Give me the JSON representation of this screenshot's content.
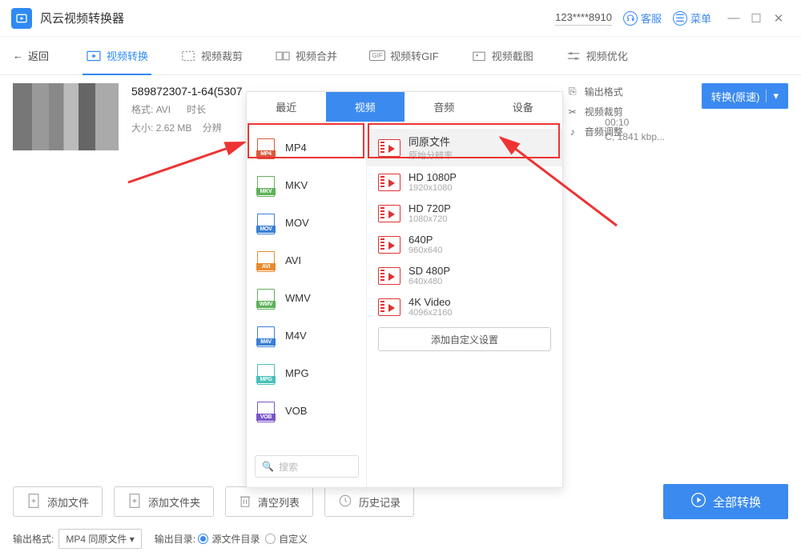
{
  "titlebar": {
    "app": "风云视频转换器",
    "account": "123****8910",
    "support": "客服",
    "menu": "菜单"
  },
  "nav": {
    "back": "返回",
    "tabs": [
      "视频转换",
      "视频裁剪",
      "视频合并",
      "视频转GIF",
      "视频截图",
      "视频优化"
    ]
  },
  "file": {
    "name": "589872307-1-64(5307",
    "format_label": "格式:",
    "format": "AVI",
    "size_label": "大小:",
    "size": "2.62 MB",
    "duration_label": "时长",
    "extra_label": "分辨",
    "duration": "00:10",
    "bitrate": "C, 1841 kbp..."
  },
  "right_links": {
    "out": "输出格式",
    "crop": "视频裁剪",
    "audio": "音频调整"
  },
  "convert_label": "转换(原速)",
  "popup": {
    "tabs": [
      "最近",
      "视频",
      "音频",
      "设备"
    ],
    "formats": [
      "MP4",
      "MKV",
      "MOV",
      "AVI",
      "WMV",
      "M4V",
      "MPG",
      "VOB"
    ],
    "format_colors": [
      "#d85a3a",
      "#5fb15a",
      "#3b7fd6",
      "#e98a2e",
      "#5fb15a",
      "#3b7fd6",
      "#46c1b8",
      "#7a56c9"
    ],
    "resolutions": [
      {
        "t": "同原文件",
        "s": "原始分辨率"
      },
      {
        "t": "HD 1080P",
        "s": "1920x1080"
      },
      {
        "t": "HD 720P",
        "s": "1080x720"
      },
      {
        "t": "640P",
        "s": "960x640"
      },
      {
        "t": "SD 480P",
        "s": "640x480"
      },
      {
        "t": "4K Video",
        "s": "4096x2160"
      }
    ],
    "search_ph": "搜索",
    "add_custom": "添加自定义设置"
  },
  "footer": {
    "add_file": "添加文件",
    "add_folder": "添加文件夹",
    "clear": "清空列表",
    "history": "历史记录",
    "convert_all": "全部转换",
    "out_format_label": "输出格式:",
    "out_format": "MP4 同原文件",
    "out_dir_label": "输出目录:",
    "src_dir": "源文件目录",
    "custom": "自定义"
  }
}
